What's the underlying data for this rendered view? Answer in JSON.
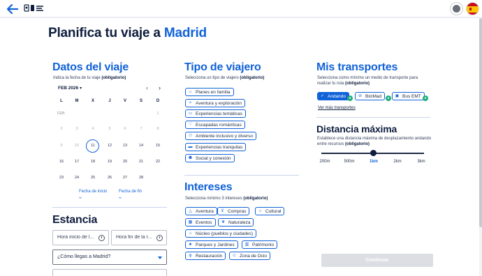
{
  "header": {
    "back_icon": "arrow-left-icon",
    "logo_icon": "madrid-logo-icon",
    "user_icon": "user-avatar-icon",
    "language_icon": "spain-flag-icon"
  },
  "page": {
    "title_prefix": "Planifica tu viaje a",
    "title_city": "Madrid"
  },
  "trip": {
    "title": "Datos del viaje",
    "subtitle": "Indica la fecha de tu viaje",
    "required": "(obligatorio)",
    "month_label": "FEB 2026",
    "month_dropdown_icon": "chevron-down-icon",
    "prev_icon": "chevron-left-icon",
    "next_icon": "chevron-right-icon",
    "weekdays": [
      "L",
      "M",
      "X",
      "J",
      "V",
      "S",
      "D"
    ],
    "row0_label": "FEB",
    "row0_day": "1",
    "weeks": [
      [
        "2",
        "3",
        "4",
        "5",
        "6",
        "7",
        "8"
      ],
      [
        "9",
        "10",
        "11",
        "12",
        "13",
        "14",
        "15"
      ],
      [
        "16",
        "17",
        "18",
        "19",
        "20",
        "21",
        "22"
      ],
      [
        "23",
        "24",
        "25",
        "26",
        "27",
        "28",
        ""
      ]
    ],
    "selected_day": "11",
    "start_label": "Fecha de inicio",
    "start_value": "–",
    "end_label": "Fecha de fin",
    "end_value": "–"
  },
  "stay": {
    "title": "Estancia",
    "start_time_placeholder": "Hora inicio de l...",
    "end_time_placeholder": "Hora fin de la r...",
    "arrival_select": "¿Cómo llegas a Madrid?",
    "clock_icon": "clock-icon"
  },
  "traveler": {
    "title": "Tipo de viajero",
    "subtitle": "Selecciona un tipo de viajero",
    "required": "(obligatorio)",
    "options": [
      {
        "label": "Planes en familia",
        "icon": "family-icon"
      },
      {
        "label": "Aventura y exploración",
        "icon": "compass-icon"
      },
      {
        "label": "Experiencias temáticas",
        "icon": "ticket-icon"
      },
      {
        "label": "Escapadas románticas",
        "icon": "heart-icon"
      },
      {
        "label": "Ambiente inclusivo y diverso",
        "icon": "accessibility-icon"
      },
      {
        "label": "Experiencias tranquilas",
        "icon": "bed-icon"
      },
      {
        "label": "Social y conexión",
        "icon": "people-icon"
      }
    ]
  },
  "interests": {
    "title": "Intereses",
    "subtitle": "Selecciona mínimo 3 intereses",
    "required": "(obligatorio)",
    "options": [
      {
        "label": "Aventura",
        "icon": "mountain-icon"
      },
      {
        "label": "Compras",
        "icon": "cart-icon"
      },
      {
        "label": "Cultural",
        "icon": "museum-icon"
      },
      {
        "label": "Eventos",
        "icon": "calendar-icon"
      },
      {
        "label": "Naturaleza",
        "icon": "leaf-icon"
      },
      {
        "label": "Núcleo (pueblos y ciudades)",
        "icon": "village-icon"
      },
      {
        "label": "Parques y Jardines",
        "icon": "tree-icon"
      },
      {
        "label": "Patrimonio",
        "icon": "building-icon"
      },
      {
        "label": "Restauración",
        "icon": "restaurant-icon"
      },
      {
        "label": "Zona de Ocio",
        "icon": "leisure-icon"
      }
    ]
  },
  "transport": {
    "title": "Mis transportes",
    "subtitle": "Selecciona como mínimo un medio de transporte para realizar tu ruta",
    "required": "(obligatorio)",
    "options": [
      {
        "label": "Andando",
        "icon": "check-icon",
        "active": true
      },
      {
        "label": "BiciMad",
        "icon": "bike-icon",
        "active": false
      },
      {
        "label": "Bus EMT",
        "icon": "bus-icon",
        "active": false
      }
    ],
    "badge_icon": "green-badge-icon",
    "more_link": "Ver más transportes"
  },
  "distance": {
    "title": "Distancia máxima",
    "subtitle": "Establece una distancia máxima de desplazamiento andando entre recursos",
    "required": "(obligatorio)",
    "ticks": [
      "200m",
      "500m",
      "1km",
      "2km",
      "3km"
    ],
    "selected": "1km"
  },
  "actions": {
    "continue_label": "Continuar"
  }
}
